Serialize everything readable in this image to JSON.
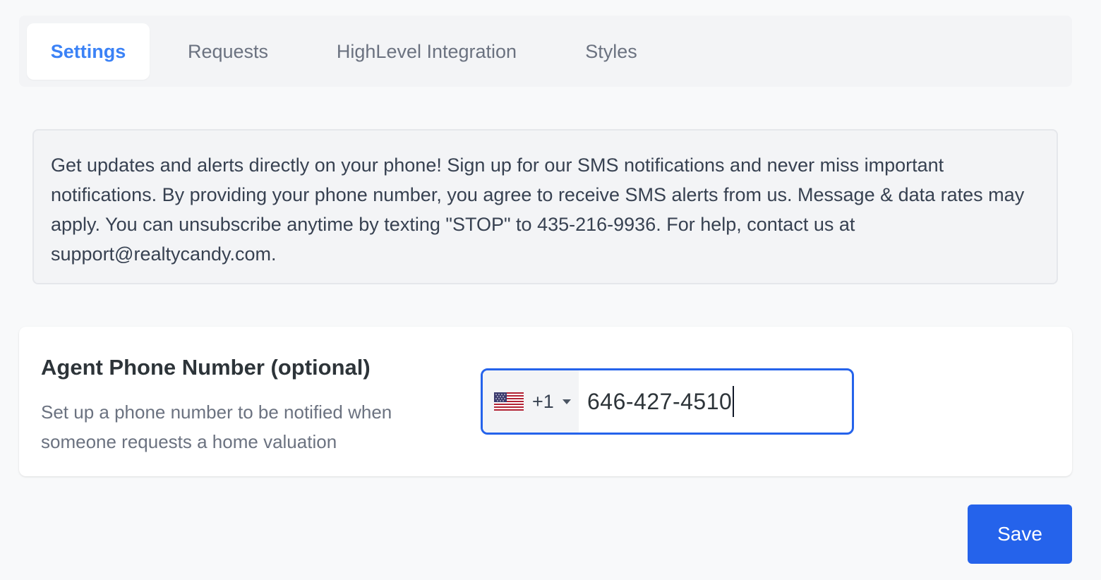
{
  "tabs": [
    {
      "label": "Settings",
      "active": true
    },
    {
      "label": "Requests",
      "active": false
    },
    {
      "label": "HighLevel Integration",
      "active": false
    },
    {
      "label": "Styles",
      "active": false
    }
  ],
  "notice": {
    "text": "Get updates and alerts directly on your phone! Sign up for our SMS notifications and never miss important notifications. By providing your phone number, you agree to receive SMS alerts from us. Message & data rates may apply. You can unsubscribe anytime by texting \"STOP\" to 435-216-9936. For help, contact us at support@realtycandy.com."
  },
  "phone_field": {
    "title": "Agent Phone Number (optional)",
    "description": "Set up a phone number to be notified when someone requests a home valuation",
    "country_flag_icon": "us-flag-icon",
    "dial_code": "+1",
    "value": "646-427-4510"
  },
  "save_button": {
    "label": "Save"
  },
  "colors": {
    "accent": "#2563eb",
    "active_tab_text": "#3b82f6",
    "page_background": "#f8f9fa",
    "notice_background": "#f3f4f6"
  }
}
